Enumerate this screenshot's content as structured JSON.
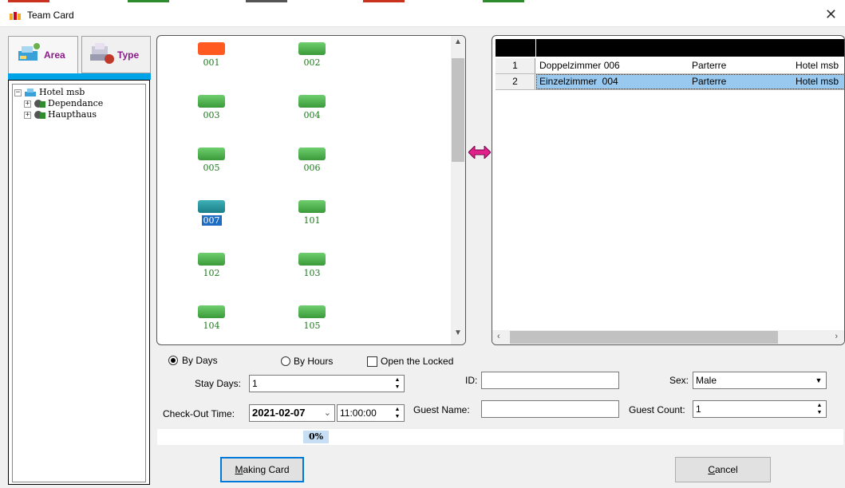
{
  "window": {
    "title": "Team Card",
    "close_glyph": "✕"
  },
  "top_strip_colors": [
    "#c8321e",
    "#2e8b2e",
    "#555555",
    "#c8321e",
    "#2e8b2e"
  ],
  "tabs": [
    {
      "label": "Area",
      "icon": "area-icon",
      "color": "#8b1a8b",
      "active": true
    },
    {
      "label": "Type",
      "icon": "type-icon",
      "color": "#8b1a8b",
      "active": false
    }
  ],
  "tree": {
    "root": {
      "label": "Hotel msb",
      "expander": "−",
      "icon": "hotel-icon"
    },
    "children": [
      {
        "label": "Dependance",
        "expander": "+",
        "icon": "building-icon"
      },
      {
        "label": "Haupthaus",
        "expander": "+",
        "icon": "building-icon"
      }
    ]
  },
  "rooms": [
    {
      "number": "001",
      "color": "#ff5a1f",
      "selected": false
    },
    {
      "number": "002",
      "color": "#4caf50",
      "selected": false
    },
    {
      "number": "003",
      "color": "#4caf50",
      "selected": false
    },
    {
      "number": "004",
      "color": "#4caf50",
      "selected": false
    },
    {
      "number": "005",
      "color": "#4caf50",
      "selected": false
    },
    {
      "number": "006",
      "color": "#4caf50",
      "selected": false
    },
    {
      "number": "007",
      "color": "#23949c",
      "selected": true
    },
    {
      "number": "101",
      "color": "#4caf50",
      "selected": false
    },
    {
      "number": "102",
      "color": "#4caf50",
      "selected": false
    },
    {
      "number": "103",
      "color": "#4caf50",
      "selected": false
    },
    {
      "number": "104",
      "color": "#4caf50",
      "selected": false
    },
    {
      "number": "105",
      "color": "#4caf50",
      "selected": false
    }
  ],
  "selected_rooms": [
    {
      "index": "1",
      "room": "Doppelzimmer 006",
      "floor": "Parterre",
      "hotel": "Hotel msb",
      "selected": false
    },
    {
      "index": "2",
      "room": "Einzelzimmer  004",
      "floor": "Parterre",
      "hotel": "Hotel msb",
      "selected": true
    }
  ],
  "mode": {
    "by_days_label": "By Days",
    "by_hours_label": "By Hours",
    "open_locked_label": "Open the Locked",
    "selected": "by_days",
    "open_locked_checked": false
  },
  "form": {
    "stay_days_label": "Stay Days:",
    "stay_days_value": "1",
    "checkout_label": "Check-Out Time:",
    "checkout_date": "2021-02-07",
    "checkout_time": "11:00:00",
    "id_label": "ID:",
    "id_value": "",
    "guest_name_label": "Guest Name:",
    "guest_name_value": "",
    "sex_label": "Sex:",
    "sex_value": "Male",
    "guest_count_label": "Guest Count:",
    "guest_count_value": "1"
  },
  "progress": {
    "text": "0%",
    "value": 0
  },
  "buttons": {
    "making_card_prefix": "M",
    "making_card_rest": "aking Card",
    "cancel_prefix": "C",
    "cancel_rest": "ancel"
  }
}
